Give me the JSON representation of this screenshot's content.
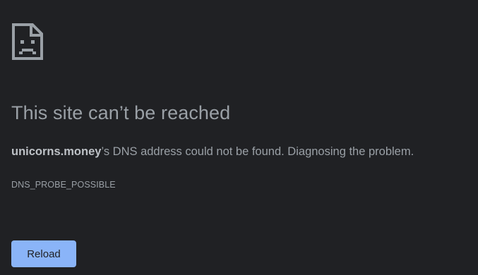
{
  "error_page": {
    "icon": "sad-page-icon",
    "title": "This site can’t be reached",
    "host": "unicorns.money",
    "message_rest": "’s DNS address could not be found. Diagnosing the problem.",
    "error_code": "DNS_PROBE_POSSIBLE",
    "reload_label": "Reload"
  },
  "colors": {
    "background": "#202124",
    "text": "#9aa0a6",
    "host_text": "#bdc1c6",
    "button_bg": "#8ab4f8",
    "button_text": "#202124"
  }
}
